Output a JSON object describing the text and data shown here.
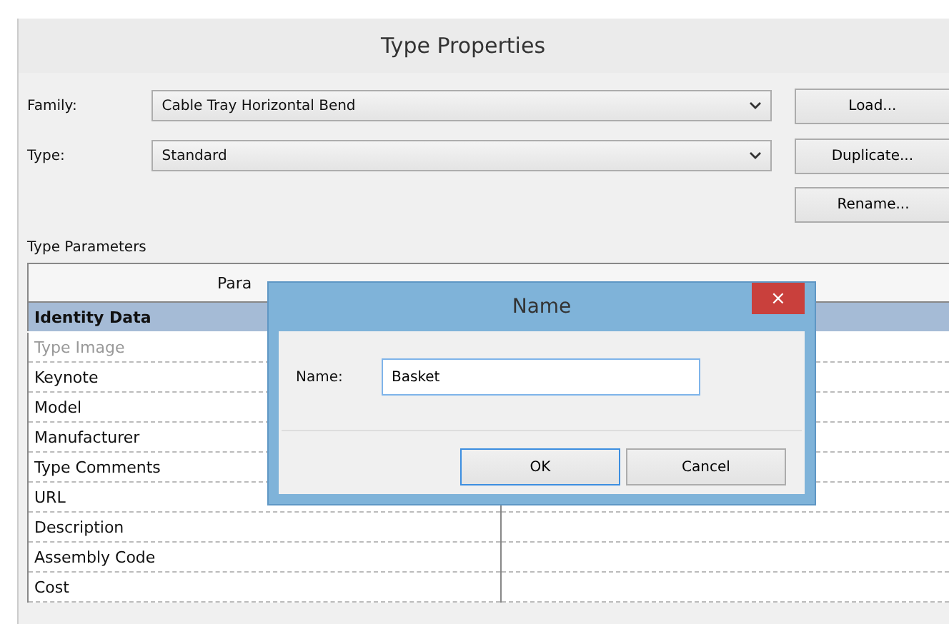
{
  "window": {
    "title": "Type Properties"
  },
  "fields": [
    {
      "label": "Family:",
      "value": "Cable Tray Horizontal Bend",
      "button": "Load..."
    },
    {
      "label": "Type:",
      "value": "Standard",
      "button": "Duplicate..."
    }
  ],
  "rename_button": "Rename...",
  "section_label": "Type Parameters",
  "table": {
    "columns": [
      "Para"
    ],
    "rows": [
      {
        "kind": "group",
        "name": "Identity Data"
      },
      {
        "kind": "param",
        "name": "Type Image",
        "disabled": true
      },
      {
        "kind": "param",
        "name": "Keynote",
        "disabled": false
      },
      {
        "kind": "param",
        "name": "Model",
        "disabled": false
      },
      {
        "kind": "param",
        "name": "Manufacturer",
        "disabled": false
      },
      {
        "kind": "param",
        "name": "Type Comments",
        "disabled": false
      },
      {
        "kind": "param",
        "name": "URL",
        "disabled": false
      },
      {
        "kind": "param",
        "name": "Description",
        "disabled": false
      },
      {
        "kind": "param",
        "name": "Assembly Code",
        "disabled": false
      },
      {
        "kind": "param",
        "name": "Cost",
        "disabled": false
      }
    ]
  },
  "dialog": {
    "title": "Name",
    "close": "×",
    "label": "Name:",
    "value": "Basket",
    "buttons": [
      {
        "label": "OK",
        "default": true
      },
      {
        "label": "Cancel",
        "default": false
      }
    ]
  }
}
